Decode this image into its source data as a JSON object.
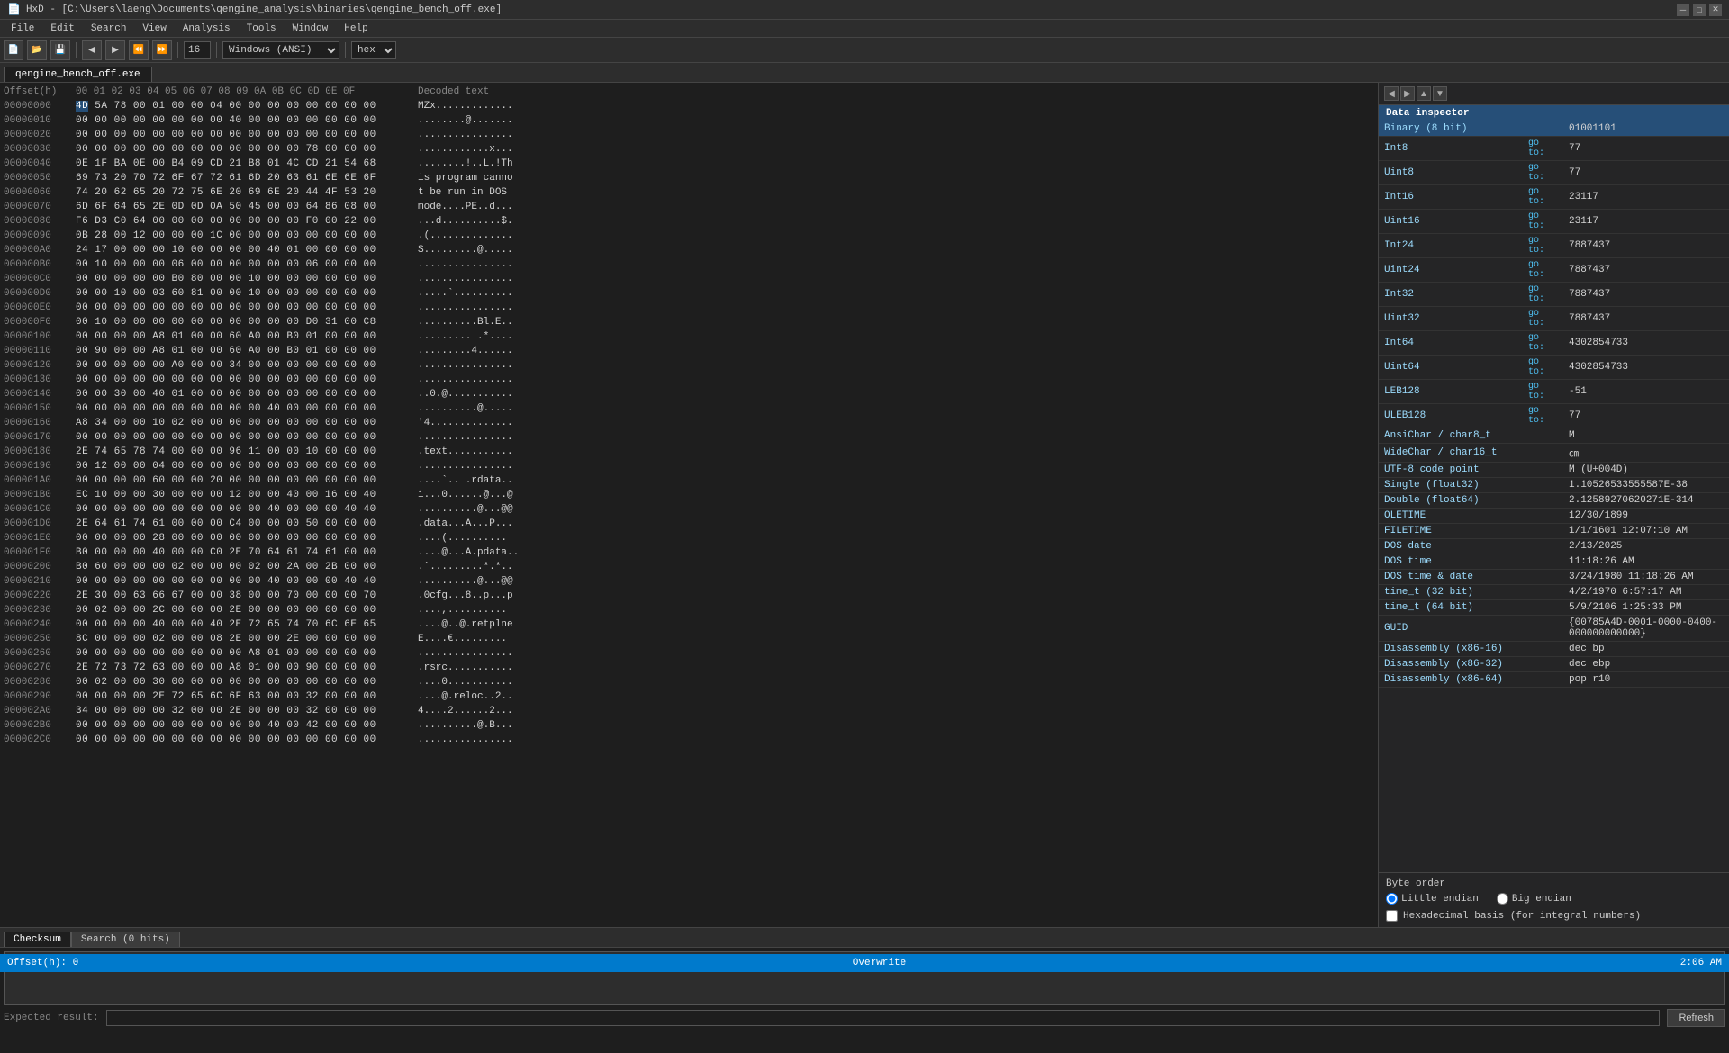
{
  "titlebar": {
    "title": "HxD - [C:\\Users\\laeng\\Documents\\qengine_analysis\\binaries\\qengine_bench_off.exe]",
    "min": "─",
    "max": "□",
    "close": "✕"
  },
  "menubar": {
    "items": [
      "File",
      "Edit",
      "Search",
      "View",
      "Analysis",
      "Tools",
      "Window",
      "Help"
    ]
  },
  "toolbar": {
    "zoom_label": "16",
    "encoding": "Windows (ANSI)",
    "view": "hex"
  },
  "tab": {
    "name": "qengine_bench_off.exe"
  },
  "hex_header": {
    "offset": "Offset(h)",
    "bytes": "00 01 02 03 04 05 06 07 08 09 0A 0B 0C 0D 0E 0F",
    "decoded": "Decoded text"
  },
  "hex_rows": [
    {
      "offset": "00000000",
      "bytes": "4D 5A 78 00 01 00 00 04 00 00 00 00 00 00 00 00",
      "decoded": "MZx............."
    },
    {
      "offset": "00000010",
      "bytes": "00 00 00 00 00 00 00 00 40 00 00 00 00 00 00 00",
      "decoded": "........@......."
    },
    {
      "offset": "00000020",
      "bytes": "00 00 00 00 00 00 00 00 00 00 00 00 00 00 00 00",
      "decoded": "................"
    },
    {
      "offset": "00000030",
      "bytes": "00 00 00 00 00 00 00 00 00 00 00 00 78 00 00 00",
      "decoded": "............x..."
    },
    {
      "offset": "00000040",
      "bytes": "0E 1F BA 0E 00 B4 09 CD 21 B8 01 4C CD 21 54 68",
      "decoded": "........!..L.!Th"
    },
    {
      "offset": "00000050",
      "bytes": "69 73 20 70 72 6F 67 72 61 6D 20 63 61 6E 6E 6F",
      "decoded": "is program canno"
    },
    {
      "offset": "00000060",
      "bytes": "74 20 62 65 20 72 75 6E 20 69 6E 20 44 4F 53 20",
      "decoded": "t be run in DOS "
    },
    {
      "offset": "00000070",
      "bytes": "6D 6F 64 65 2E 0D 0D 0A 50 45 00 00 64 86 08 00",
      "decoded": "mode....PE..d..."
    },
    {
      "offset": "00000080",
      "bytes": "F6 D3 C0 64 00 00 00 00 00 00 00 00 F0 00 22 00",
      "decoded": "...d..........$."
    },
    {
      "offset": "00000090",
      "bytes": "0B 28 00 12 00 00 00 1C 00 00 00 00 00 00 00 00",
      "decoded": ".(.............."
    },
    {
      "offset": "000000A0",
      "bytes": "24 17 00 00 00 10 00 00 00 00 40 01 00 00 00 00",
      "decoded": "$.........@....."
    },
    {
      "offset": "000000B0",
      "bytes": "00 10 00 00 00 06 00 00 00 00 00 00 06 00 00 00",
      "decoded": "................"
    },
    {
      "offset": "000000C0",
      "bytes": "00 00 00 00 00 B0 80 00 00 10 00 00 00 00 00 00",
      "decoded": "................"
    },
    {
      "offset": "000000D0",
      "bytes": "00 00 10 00 03 60 81 00 00 10 00 00 00 00 00 00",
      "decoded": ".....`.........."
    },
    {
      "offset": "000000E0",
      "bytes": "00 00 00 00 00 00 00 00 00 00 00 00 00 00 00 00",
      "decoded": "................"
    },
    {
      "offset": "000000F0",
      "bytes": "00 10 00 00 00 00 00 00 00 00 00 00 D0 31 00 C8",
      "decoded": "..........Bl.E.."
    },
    {
      "offset": "00000100",
      "bytes": "00 00 00 00 A8 01 00 00 60 A0 00 B0 01 00 00 00",
      "decoded": "......... .*...."
    },
    {
      "offset": "00000110",
      "bytes": "00 90 00 00 A8 01 00 00 60 A0 00 B0 01 00 00 00",
      "decoded": ".........4......"
    },
    {
      "offset": "00000120",
      "bytes": "00 00 00 00 00 A0 00 00 34 00 00 00 00 00 00 00",
      "decoded": "................"
    },
    {
      "offset": "00000130",
      "bytes": "00 00 00 00 00 00 00 00 00 00 00 00 00 00 00 00",
      "decoded": "................"
    },
    {
      "offset": "00000140",
      "bytes": "00 00 30 00 40 01 00 00 00 00 00 00 00 00 00 00",
      "decoded": "..0.@..........."
    },
    {
      "offset": "00000150",
      "bytes": "00 00 00 00 00 00 00 00 00 00 40 00 00 00 00 00",
      "decoded": "..........@....."
    },
    {
      "offset": "00000160",
      "bytes": "A8 34 00 00 10 02 00 00 00 00 00 00 00 00 00 00",
      "decoded": "'4.............."
    },
    {
      "offset": "00000170",
      "bytes": "00 00 00 00 00 00 00 00 00 00 00 00 00 00 00 00",
      "decoded": "................"
    },
    {
      "offset": "00000180",
      "bytes": "2E 74 65 78 74 00 00 00 96 11 00 00 10 00 00 00",
      "decoded": ".text..........."
    },
    {
      "offset": "00000190",
      "bytes": "00 12 00 00 04 00 00 00 00 00 00 00 00 00 00 00",
      "decoded": "................"
    },
    {
      "offset": "000001A0",
      "bytes": "00 00 00 00 60 00 00 20 00 00 00 00 00 00 00 00",
      "decoded": "....`.. .rdata.."
    },
    {
      "offset": "000001B0",
      "bytes": "EC 10 00 00 30 00 00 00 12 00 00 40 00 16 00 40",
      "decoded": "i...0......@...@"
    },
    {
      "offset": "000001C0",
      "bytes": "00 00 00 00 00 00 00 00 00 00 40 00 00 00 40 40",
      "decoded": "..........@...@@"
    },
    {
      "offset": "000001D0",
      "bytes": "2E 64 61 74 61 00 00 00 C4 00 00 00 50 00 00 00",
      "decoded": ".data...A...P..."
    },
    {
      "offset": "000001E0",
      "bytes": "00 00 00 00 28 00 00 00 00 00 00 00 00 00 00 00",
      "decoded": "....(.........."
    },
    {
      "offset": "000001F0",
      "bytes": "B0 00 00 00 40 00 00 C0 2E 70 64 61 74 61 00 00",
      "decoded": "....@...A.pdata.."
    },
    {
      "offset": "00000200",
      "bytes": "B0 60 00 00 00 02 00 00 00 02 00 2A 00 2B 00 00",
      "decoded": ".`.........*.*.."
    },
    {
      "offset": "00000210",
      "bytes": "00 00 00 00 00 00 00 00 00 00 40 00 00 00 40 40",
      "decoded": "..........@...@@"
    },
    {
      "offset": "00000220",
      "bytes": "2E 30 00 63 66 67 00 00 38 00 00 70 00 00 00 70",
      "decoded": ".0cfg...8..p...p"
    },
    {
      "offset": "00000230",
      "bytes": "00 02 00 00 2C 00 00 00 2E 00 00 00 00 00 00 00",
      "decoded": "....,.......... "
    },
    {
      "offset": "00000240",
      "bytes": "00 00 00 00 40 00 00 40 2E 72 65 74 70 6C 6E 65",
      "decoded": "....@..@.retplne"
    },
    {
      "offset": "00000250",
      "bytes": "8C 00 00 00 02 00 00 08 2E 00 00 2E 00 00 00 00",
      "decoded": "E....€........."
    },
    {
      "offset": "00000260",
      "bytes": "00 00 00 00 00 00 00 00 00 A8 01 00 00 00 00 00",
      "decoded": "................"
    },
    {
      "offset": "00000270",
      "bytes": "2E 72 73 72 63 00 00 00 A8 01 00 00 90 00 00 00",
      "decoded": ".rsrc..........."
    },
    {
      "offset": "00000280",
      "bytes": "00 02 00 00 30 00 00 00 00 00 00 00 00 00 00 00",
      "decoded": "....0..........."
    },
    {
      "offset": "00000290",
      "bytes": "00 00 00 00 2E 72 65 6C 6F 63 00 00 32 00 00 00",
      "decoded": "....@.reloc..2.."
    },
    {
      "offset": "000002A0",
      "bytes": "34 00 00 00 00 32 00 00 2E 00 00 00 32 00 00 00",
      "decoded": "4....2......2..."
    },
    {
      "offset": "000002B0",
      "bytes": "00 00 00 00 00 00 00 00 00 00 40 00 42 00 00 00",
      "decoded": "..........@.B..."
    },
    {
      "offset": "000002C0",
      "bytes": "00 00 00 00 00 00 00 00 00 00 00 00 00 00 00 00",
      "decoded": "................"
    }
  ],
  "data_inspector": {
    "title": "Data inspector",
    "rows": [
      {
        "type": "Binary (8 bit)",
        "goto": null,
        "value": "01001101",
        "selected": true
      },
      {
        "type": "Int8",
        "goto": "go to:",
        "value": "77"
      },
      {
        "type": "Uint8",
        "goto": "go to:",
        "value": "77"
      },
      {
        "type": "Int16",
        "goto": "go to:",
        "value": "23117"
      },
      {
        "type": "Uint16",
        "goto": "go to:",
        "value": "23117"
      },
      {
        "type": "Int24",
        "goto": "go to:",
        "value": "7887437"
      },
      {
        "type": "Uint24",
        "goto": "go to:",
        "value": "7887437"
      },
      {
        "type": "Int32",
        "goto": "go to:",
        "value": "7887437"
      },
      {
        "type": "Uint32",
        "goto": "go to:",
        "value": "7887437"
      },
      {
        "type": "Int64",
        "goto": "go to:",
        "value": "4302854733"
      },
      {
        "type": "Uint64",
        "goto": "go to:",
        "value": "4302854733"
      },
      {
        "type": "LEB128",
        "goto": "go to:",
        "value": "-51"
      },
      {
        "type": "ULEB128",
        "goto": "go to:",
        "value": "77"
      },
      {
        "type": "AnsiChar / char8_t",
        "goto": null,
        "value": "M"
      },
      {
        "type": "WideChar / char16_t",
        "goto": null,
        "value": "㎝"
      },
      {
        "type": "UTF-8 code point",
        "goto": null,
        "value": "M (U+004D)"
      },
      {
        "type": "Single (float32)",
        "goto": null,
        "value": "1.10526533555587E-38"
      },
      {
        "type": "Double (float64)",
        "goto": null,
        "value": "2.12589270620271E-314"
      },
      {
        "type": "OLETIME",
        "goto": null,
        "value": "12/30/1899"
      },
      {
        "type": "FILETIME",
        "goto": null,
        "value": "1/1/1601 12:07:10 AM"
      },
      {
        "type": "DOS date",
        "goto": null,
        "value": "2/13/2025"
      },
      {
        "type": "DOS time",
        "goto": null,
        "value": "11:18:26 AM"
      },
      {
        "type": "DOS time & date",
        "goto": null,
        "value": "3/24/1980 11:18:26 AM"
      },
      {
        "type": "time_t (32 bit)",
        "goto": null,
        "value": "4/2/1970 6:57:17 AM"
      },
      {
        "type": "time_t (64 bit)",
        "goto": null,
        "value": "5/9/2106 1:25:33 PM"
      },
      {
        "type": "GUID",
        "goto": null,
        "value": "{00785A4D-0001-0000-0400-000000000000}"
      },
      {
        "type": "Disassembly (x86-16)",
        "goto": null,
        "value": "dec bp"
      },
      {
        "type": "Disassembly (x86-32)",
        "goto": null,
        "value": "dec ebp"
      },
      {
        "type": "Disassembly (x86-64)",
        "goto": null,
        "value": "pop r10"
      }
    ]
  },
  "byte_order": {
    "title": "Byte order",
    "little_endian": "Little endian",
    "big_endian": "Big endian",
    "hex_basis": "Hexadecimal basis (for integral numbers)"
  },
  "bottom": {
    "tabs": [
      "Checksum",
      "Search (0 hits)"
    ],
    "expected_label": "Expected result:",
    "refresh_label": "Refresh"
  },
  "statusbar": {
    "left": "Offset(h): 0",
    "center": "Overwrite",
    "right": "2:06 AM"
  }
}
